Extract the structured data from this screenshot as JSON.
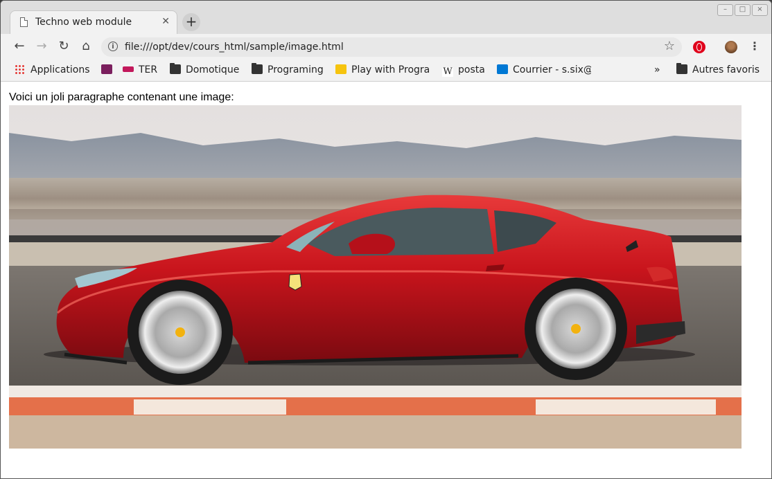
{
  "tab": {
    "title": "Techno web module",
    "close": "✕"
  },
  "newtab_label": "+",
  "address": {
    "url": "file:///opt/dev/cours_html/sample/image.html",
    "info": "i"
  },
  "bookmarks": [
    {
      "label": "Applications",
      "icon": "apps-grid-icon"
    },
    {
      "label": "",
      "icon": "fb-bookmark-icon"
    },
    {
      "label": "TER",
      "icon": "sncf-icon"
    },
    {
      "label": "Domotique",
      "icon": "folder-icon"
    },
    {
      "label": "Programing",
      "icon": "folder-icon"
    },
    {
      "label": "Play with Progra",
      "icon": "play-icon"
    },
    {
      "label": "posta",
      "icon": "wikipedia-icon"
    },
    {
      "label": "Courrier - s.six@",
      "icon": "outlook-icon"
    },
    {
      "label": "Autres favoris",
      "icon": "folder-icon"
    }
  ],
  "overflow": "»",
  "page": {
    "paragraph": "Voici un joli paragraphe contenant une image:"
  },
  "colors": {
    "car": "#c8141c",
    "sky": "#e9e6e6",
    "track": "#6d6862"
  }
}
